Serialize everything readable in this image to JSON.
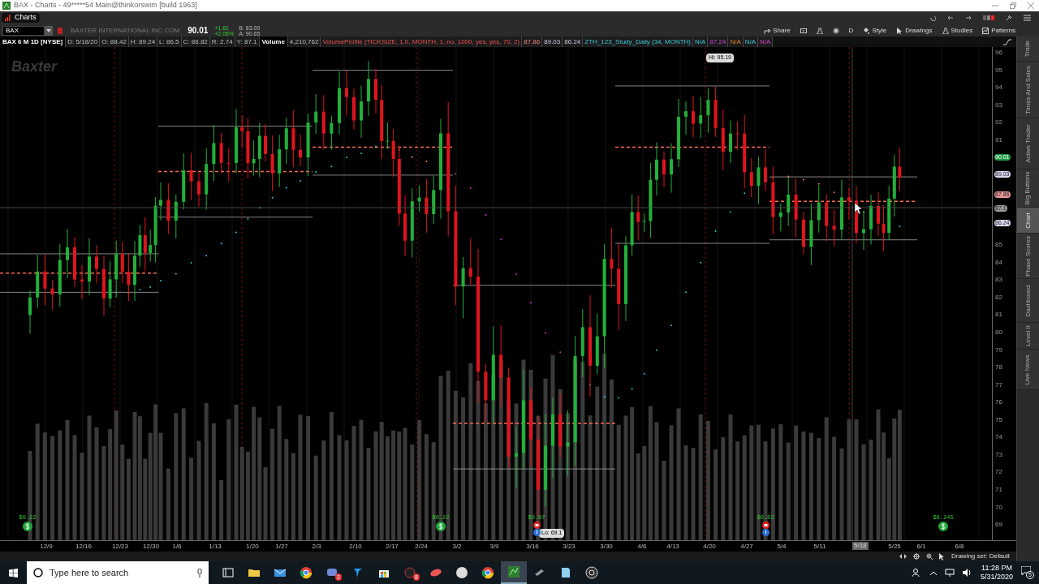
{
  "window": {
    "title": "BAX - Charts - 49*****54 Main@thinkorswim [build 1963]"
  },
  "tabs": [
    {
      "label": "Charts",
      "selected": true
    }
  ],
  "symbol": {
    "value": "BAX",
    "company": "BAXTER INTERNATIONAL INC COM",
    "last": "90.01",
    "change": "+1.81",
    "change_pct": "+2.05%",
    "bid": "B: 83.00",
    "ask": "A: 90.65"
  },
  "toolbar": [
    {
      "label": "Share",
      "kind": "share"
    },
    {
      "kind": "alert"
    },
    {
      "kind": "flask"
    },
    {
      "kind": "gear"
    },
    {
      "label": "D",
      "kind": "text"
    },
    {
      "label": "Style",
      "kind": "style"
    },
    {
      "label": "Drawings",
      "kind": "cursor"
    },
    {
      "label": "Studies",
      "kind": "flask"
    },
    {
      "label": "Patterns",
      "kind": "patterns"
    }
  ],
  "header_fields": [
    {
      "text": "BAX 6 M 1D [NYSE]",
      "kind": "title"
    },
    {
      "text": "D: 5/18/20",
      "kind": "field"
    },
    {
      "text": "O: 88.42",
      "kind": "field"
    },
    {
      "text": "H: 89.24",
      "kind": "field"
    },
    {
      "text": "L: 86.5",
      "kind": "field"
    },
    {
      "text": "C: 86.82",
      "kind": "field"
    },
    {
      "text": "R: 2.74",
      "kind": "field"
    },
    {
      "text": "Y: 87.1",
      "kind": "field"
    },
    {
      "text": "Volume",
      "kind": "title"
    },
    {
      "text": "4,210,762",
      "kind": "field"
    },
    {
      "text": "VolumeProfile (TICKSIZE, 1.0, MONTH, 1, no, 1000, yes, yes, 70, 2)",
      "kind": "profile"
    },
    {
      "text": "87.86",
      "kind": "profile-value"
    },
    {
      "text": "89.03",
      "kind": "value"
    },
    {
      "text": "86.24",
      "kind": "value"
    },
    {
      "text": "ZTH_123_Study_Daily (34, MONTH)",
      "kind": "study"
    },
    {
      "text": "N/A",
      "kind": "study"
    },
    {
      "text": "87.24",
      "kind": "study-magenta"
    },
    {
      "text": "N/A",
      "kind": "study-orange"
    },
    {
      "text": "N/A",
      "kind": "study"
    },
    {
      "text": "N/A",
      "kind": "study-magenta"
    }
  ],
  "chart": {
    "watermark": "Baxter",
    "hi_label": "Hi: 95.19",
    "lo_label": "Lo: 69.1",
    "events": [
      {
        "kind": "dividend",
        "text": "$0.22"
      },
      {
        "kind": "dividend",
        "text": "$0.22"
      },
      {
        "kind": "earnings",
        "text": "$0.97"
      },
      {
        "kind": "earnings",
        "text": "$0.82"
      },
      {
        "kind": "dividend",
        "text": "$0.245"
      }
    ]
  },
  "price_axis": {
    "labels": [
      "96",
      "95",
      "94",
      "93",
      "92",
      "91",
      "85",
      "84",
      "83",
      "82",
      "81",
      "80",
      "79",
      "78",
      "77",
      "76",
      "75",
      "74",
      "73",
      "72",
      "71",
      "70",
      "69"
    ],
    "badges": [
      {
        "text": "90.01",
        "color": "#1f9a44"
      },
      {
        "text": "89.03",
        "color": "#d8d8f0"
      },
      {
        "text": "87.86",
        "color": "#e89898"
      },
      {
        "text": "87.1",
        "color": "#9a9a9a"
      },
      {
        "text": "86.24",
        "color": "#d8d8f0"
      }
    ]
  },
  "date_axis": {
    "labels": [
      "12/9",
      "12/16",
      "12/23",
      "12/30",
      "1/6",
      "1/13",
      "1/20",
      "1/27",
      "2/3",
      "2/10",
      "2/17",
      "2/24",
      "3/2",
      "3/9",
      "3/16",
      "3/23",
      "3/30",
      "4/6",
      "4/13",
      "4/20",
      "4/27",
      "5/4",
      "5/11",
      "5/25",
      "6/1",
      "6/8"
    ],
    "cursor_label": "5/18"
  },
  "side_tabs": [
    {
      "label": "Trade",
      "selected": false
    },
    {
      "label": "Times And Sales",
      "selected": false
    },
    {
      "label": "Active Trader",
      "selected": false
    },
    {
      "label": "Big Buttons",
      "selected": false
    },
    {
      "label": "Chart",
      "selected": true
    },
    {
      "label": "Phase Scores",
      "selected": false
    },
    {
      "label": "Dashboard",
      "selected": false
    },
    {
      "label": "Level II",
      "selected": false
    },
    {
      "label": "Live News",
      "selected": false
    }
  ],
  "status": {
    "drawing_set": "Drawing set: Default"
  },
  "taskbar": {
    "search_placeholder": "Type here to search",
    "apps": [
      {
        "kind": "taskview",
        "selected": false
      },
      {
        "kind": "folder",
        "selected": false
      },
      {
        "kind": "mail",
        "selected": false
      },
      {
        "kind": "browser",
        "selected": false
      },
      {
        "kind": "chat",
        "badge": "2",
        "selected": false
      },
      {
        "kind": "bird",
        "selected": false
      },
      {
        "kind": "store",
        "selected": false
      },
      {
        "kind": "pen",
        "badge": "8",
        "selected": false
      },
      {
        "kind": "satellite",
        "selected": false
      },
      {
        "kind": "compass",
        "selected": false
      },
      {
        "kind": "browser",
        "selected": false
      },
      {
        "kind": "chart",
        "selected": true
      },
      {
        "kind": "tool",
        "selected": false
      },
      {
        "kind": "notepad",
        "selected": false
      },
      {
        "kind": "aperture",
        "selected": false
      }
    ],
    "time": "11:28 PM",
    "date": "5/31/2020",
    "notifications": "5"
  }
}
